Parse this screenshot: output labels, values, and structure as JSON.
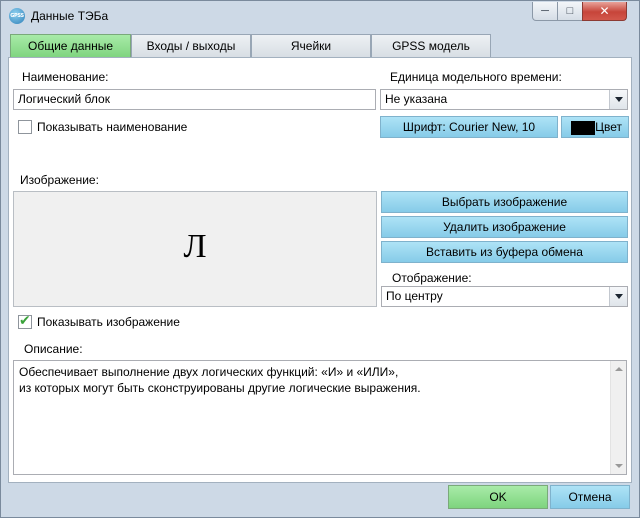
{
  "window": {
    "title": "Данные ТЭБа",
    "icon_text": "GPSS",
    "icon": "app-logo-icon",
    "minimize_icon": "minimize-icon",
    "maximize_icon": "maximize-icon",
    "close_icon": "close-icon"
  },
  "tabs": [
    {
      "label": "Общие данные",
      "active": true
    },
    {
      "label": "Входы / выходы",
      "active": false
    },
    {
      "label": "Ячейки",
      "active": false
    },
    {
      "label": "GPSS модель",
      "active": false
    }
  ],
  "general": {
    "name_label": "Наименование:",
    "name_value": "Логический блок",
    "show_name_label": "Показывать наименование",
    "show_name_checked": false,
    "time_unit_label": "Единица модельного времени:",
    "time_unit_value": "Не указана",
    "font_button": "Шрифт: Courier New, 10",
    "color_button": "Цвет",
    "color_swatch": "#000000"
  },
  "image": {
    "label": "Изображение:",
    "preview_char": "Л",
    "select_button": "Выбрать изображение",
    "delete_button": "Удалить изображение",
    "paste_button": "Вставить из буфера обмена",
    "display_label": "Отображение:",
    "display_value": "По центру",
    "show_image_label": "Показывать изображение",
    "show_image_checked": true
  },
  "description": {
    "label": "Описание:",
    "line1": "Обеспечивает выполнение двух логических функций: «И» и «ИЛИ»,",
    "line2": "из которых могут быть сконструированы другие логические выражения."
  },
  "footer": {
    "ok": "OK",
    "cancel": "Отмена"
  },
  "colors": {
    "accent_green": "#8fdc8f",
    "accent_blue": "#9bd6ef",
    "window_bg": "#cdd9e6"
  }
}
